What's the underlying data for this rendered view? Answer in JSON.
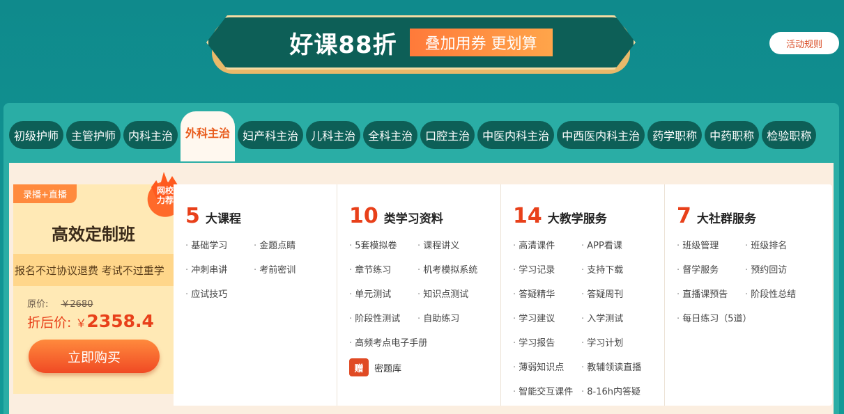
{
  "banner": {
    "title": "好课88折",
    "subtitle": "叠加用券 更划算"
  },
  "rules_button": "活动规则",
  "tabs": [
    {
      "label": "初级护师"
    },
    {
      "label": "主管护师"
    },
    {
      "label": "内科主治"
    },
    {
      "label": "外科主治",
      "active": true
    },
    {
      "label": "妇产科主治"
    },
    {
      "label": "儿科主治"
    },
    {
      "label": "全科主治"
    },
    {
      "label": "口腔主治"
    },
    {
      "label": "中医内科主治"
    },
    {
      "label": "中西医内科主治"
    },
    {
      "label": "药学职称"
    },
    {
      "label": "中药职称"
    },
    {
      "label": "检验职称"
    }
  ],
  "card": {
    "tag": "录播+直播",
    "badge_line1": "网校",
    "badge_line2": "力荐",
    "title": "高效定制班",
    "strip": "报名不过协议退费 考试不过重学",
    "orig_label": "原价:",
    "orig_price": "￥2680",
    "sale_label": "折后价:",
    "sale_currency": "￥",
    "sale_price": "2358.4",
    "buy": "立即购买"
  },
  "columns": [
    {
      "num": "5",
      "name": "大课程",
      "items": [
        "基础学习",
        "金题点睛",
        "冲刺串讲",
        "考前密训",
        "应试技巧"
      ]
    },
    {
      "num": "10",
      "name": "类学习资料",
      "items": [
        "5套模拟卷",
        "课程讲义",
        "章节练习",
        "机考模拟系统",
        "单元测试",
        "知识点测试",
        "阶段性测试",
        "自助练习",
        "高频考点电子手册"
      ],
      "bonus_icon": "赠",
      "bonus_text": "密题库"
    },
    {
      "num": "14",
      "name": "大教学服务",
      "items": [
        "高清课件",
        "APP看课",
        "学习记录",
        "支持下载",
        "答疑精华",
        "答疑周刊",
        "学习建议",
        "入学测试",
        "学习报告",
        "学习计划",
        "薄弱知识点",
        "教辅领读直播",
        "智能交互课件",
        "8-16h内答疑"
      ]
    },
    {
      "num": "7",
      "name": "大社群服务",
      "items": [
        "班级管理",
        "班级排名",
        "督学服务",
        "预约回访",
        "直播课预告",
        "阶段性总结",
        "每日练习（5道）"
      ]
    }
  ]
}
